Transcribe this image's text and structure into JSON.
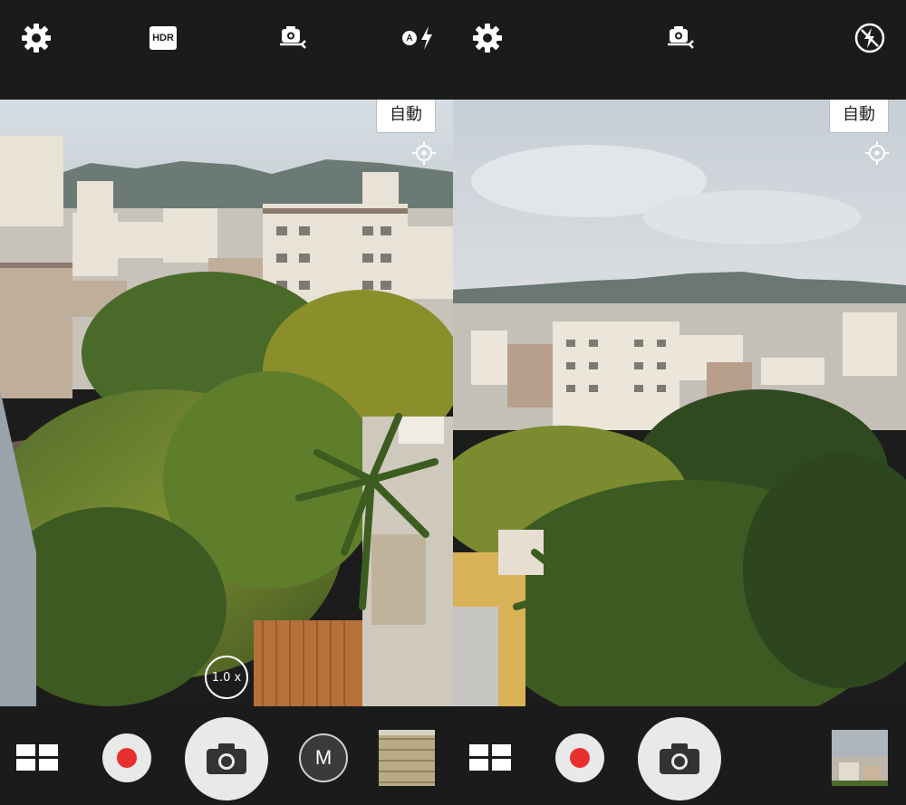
{
  "left": {
    "top_icons": [
      "settings-gear-icon",
      "hdr-icon",
      "switch-camera-icon",
      "auto-flash-icon"
    ],
    "hdr_label": "HDR",
    "flash_auto_label": "A",
    "mode_label": "自動",
    "zoom_label": "1.0 x",
    "manual_label": "M",
    "bottom_icons": [
      "grid-mode-icon",
      "record-icon",
      "camera-icon",
      "manual-mode-icon",
      "gallery-thumbnail"
    ]
  },
  "right": {
    "top_icons": [
      "settings-gear-icon",
      "switch-camera-icon",
      "flash-off-icon"
    ],
    "mode_label": "自動",
    "bottom_icons": [
      "grid-mode-icon",
      "record-icon",
      "camera-icon",
      "gallery-thumbnail"
    ]
  },
  "colors": {
    "bar": "#1b1b1b",
    "record_red": "#e8302e",
    "shutter_bg": "#e9e9e9",
    "chip_bg": "#ffffff"
  }
}
